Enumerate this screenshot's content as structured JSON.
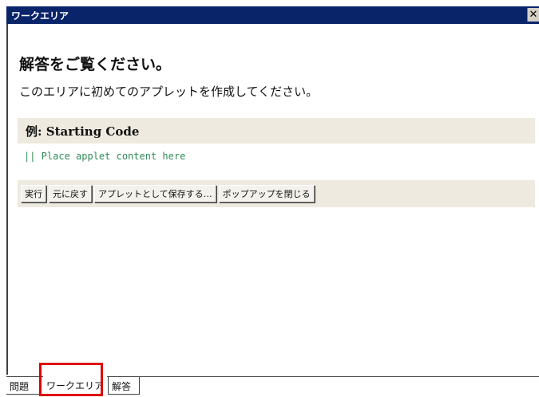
{
  "window": {
    "title": "ワークエリア",
    "close_glyph": "✕"
  },
  "content": {
    "heading": "解答をご覧ください。",
    "instruction": "このエリアに初めてのアプレットを作成してください。"
  },
  "example": {
    "label_prefix": "例",
    "label_suffix": ": Starting Code",
    "code": "|| Place applet content here",
    "code_color": "#2e8b57"
  },
  "buttons": {
    "run": "実行",
    "undo": "元に戻す",
    "save_as_applet": "アプレットとして保存する…",
    "close_popup": "ポップアップを閉じる"
  },
  "tabs": {
    "problem": "問題",
    "workarea": "ワークエリア",
    "answer": "解答"
  },
  "colors": {
    "titlebar": "#0a246a",
    "highlight": "#e00000"
  }
}
